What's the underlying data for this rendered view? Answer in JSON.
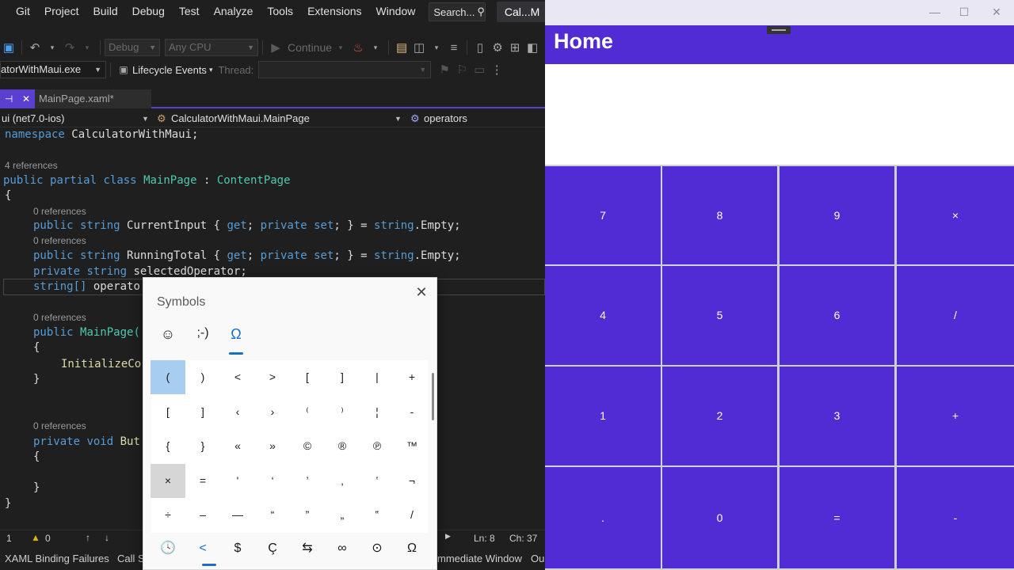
{
  "ide": {
    "menu": [
      "Git",
      "Project",
      "Build",
      "Debug",
      "Test",
      "Analyze",
      "Tools",
      "Extensions",
      "Window"
    ],
    "search_label": "Search...",
    "solution_title": "Cal...M",
    "toolbar": {
      "config": "Debug",
      "platform": "Any CPU",
      "continue": "Continue",
      "startup_item": "atorWithMaui.exe",
      "lifecycle": "Lifecycle Events",
      "thread_label": "Thread:"
    },
    "tabs": {
      "pin": "⊣",
      "close": "✕",
      "file": "MainPage.xaml*"
    },
    "navbar": {
      "project": "ui (net7.0-ios)",
      "type": "CalculatorWithMaui.MainPage",
      "member": "operators"
    },
    "code": {
      "ns_kw": "namespace",
      "ns_name": "CalculatorWithMaui;",
      "refs4": "4 references",
      "refs0": "0 references",
      "public": "public",
      "partial": "partial",
      "class": "class",
      "class_name": "MainPage",
      "colon": ":",
      "base": "ContentPage",
      "open_brace": "{",
      "close_brace": "}",
      "string": "string",
      "current_input": "CurrentInput",
      "running_total": "RunningTotal",
      "getset_1": "{",
      "get": "get",
      "private": "private",
      "set": "set",
      "getset_tail": "; } =",
      "empty": "string",
      "empty_tail": ".Empty;",
      "semi_after_get": ";",
      "selected_operator": "selectedOperator;",
      "string_arr": "string[]",
      "operators_partial": "operato",
      "ctor_name": "MainPage(",
      "init": "InitializeCo",
      "void": "void",
      "but": "But"
    },
    "status": {
      "line_no": "1",
      "warnings": "0",
      "ln": "Ln: 8",
      "ch": "Ch: 37"
    },
    "bottom_tabs": [
      "XAML Binding Failures",
      "Call S",
      "mmediate Window",
      "Ou"
    ]
  },
  "symbols": {
    "title": "Symbols",
    "close": "✕",
    "tabs": [
      "☺",
      ";-)",
      "Ω"
    ],
    "grid": [
      [
        "(",
        ")",
        "<",
        ">",
        "[",
        "]",
        "|",
        "+"
      ],
      [
        "[",
        "]",
        "‹",
        "›",
        "⁽",
        "⁾",
        "¦",
        "-"
      ],
      [
        "{",
        "}",
        "«",
        "»",
        "©",
        "®",
        "℗",
        "™"
      ],
      [
        "×",
        "=",
        "'",
        "‘",
        "’",
        "‚",
        "‛",
        "¬"
      ],
      [
        "÷",
        "–",
        "—",
        "“",
        "”",
        "„",
        "‟",
        "/"
      ]
    ],
    "recent": [
      "🕓",
      "<",
      "$",
      "Ç",
      "⇆",
      "∞",
      "⊙",
      "Ω"
    ]
  },
  "app": {
    "window_controls": [
      "—",
      "☐",
      "✕"
    ],
    "heading": "Home",
    "display": "",
    "keys": [
      [
        "7",
        "8",
        "9",
        "×"
      ],
      [
        "4",
        "5",
        "6",
        "/"
      ],
      [
        "1",
        "2",
        "3",
        "+"
      ],
      [
        ".",
        "0",
        "=",
        "-"
      ]
    ]
  }
}
